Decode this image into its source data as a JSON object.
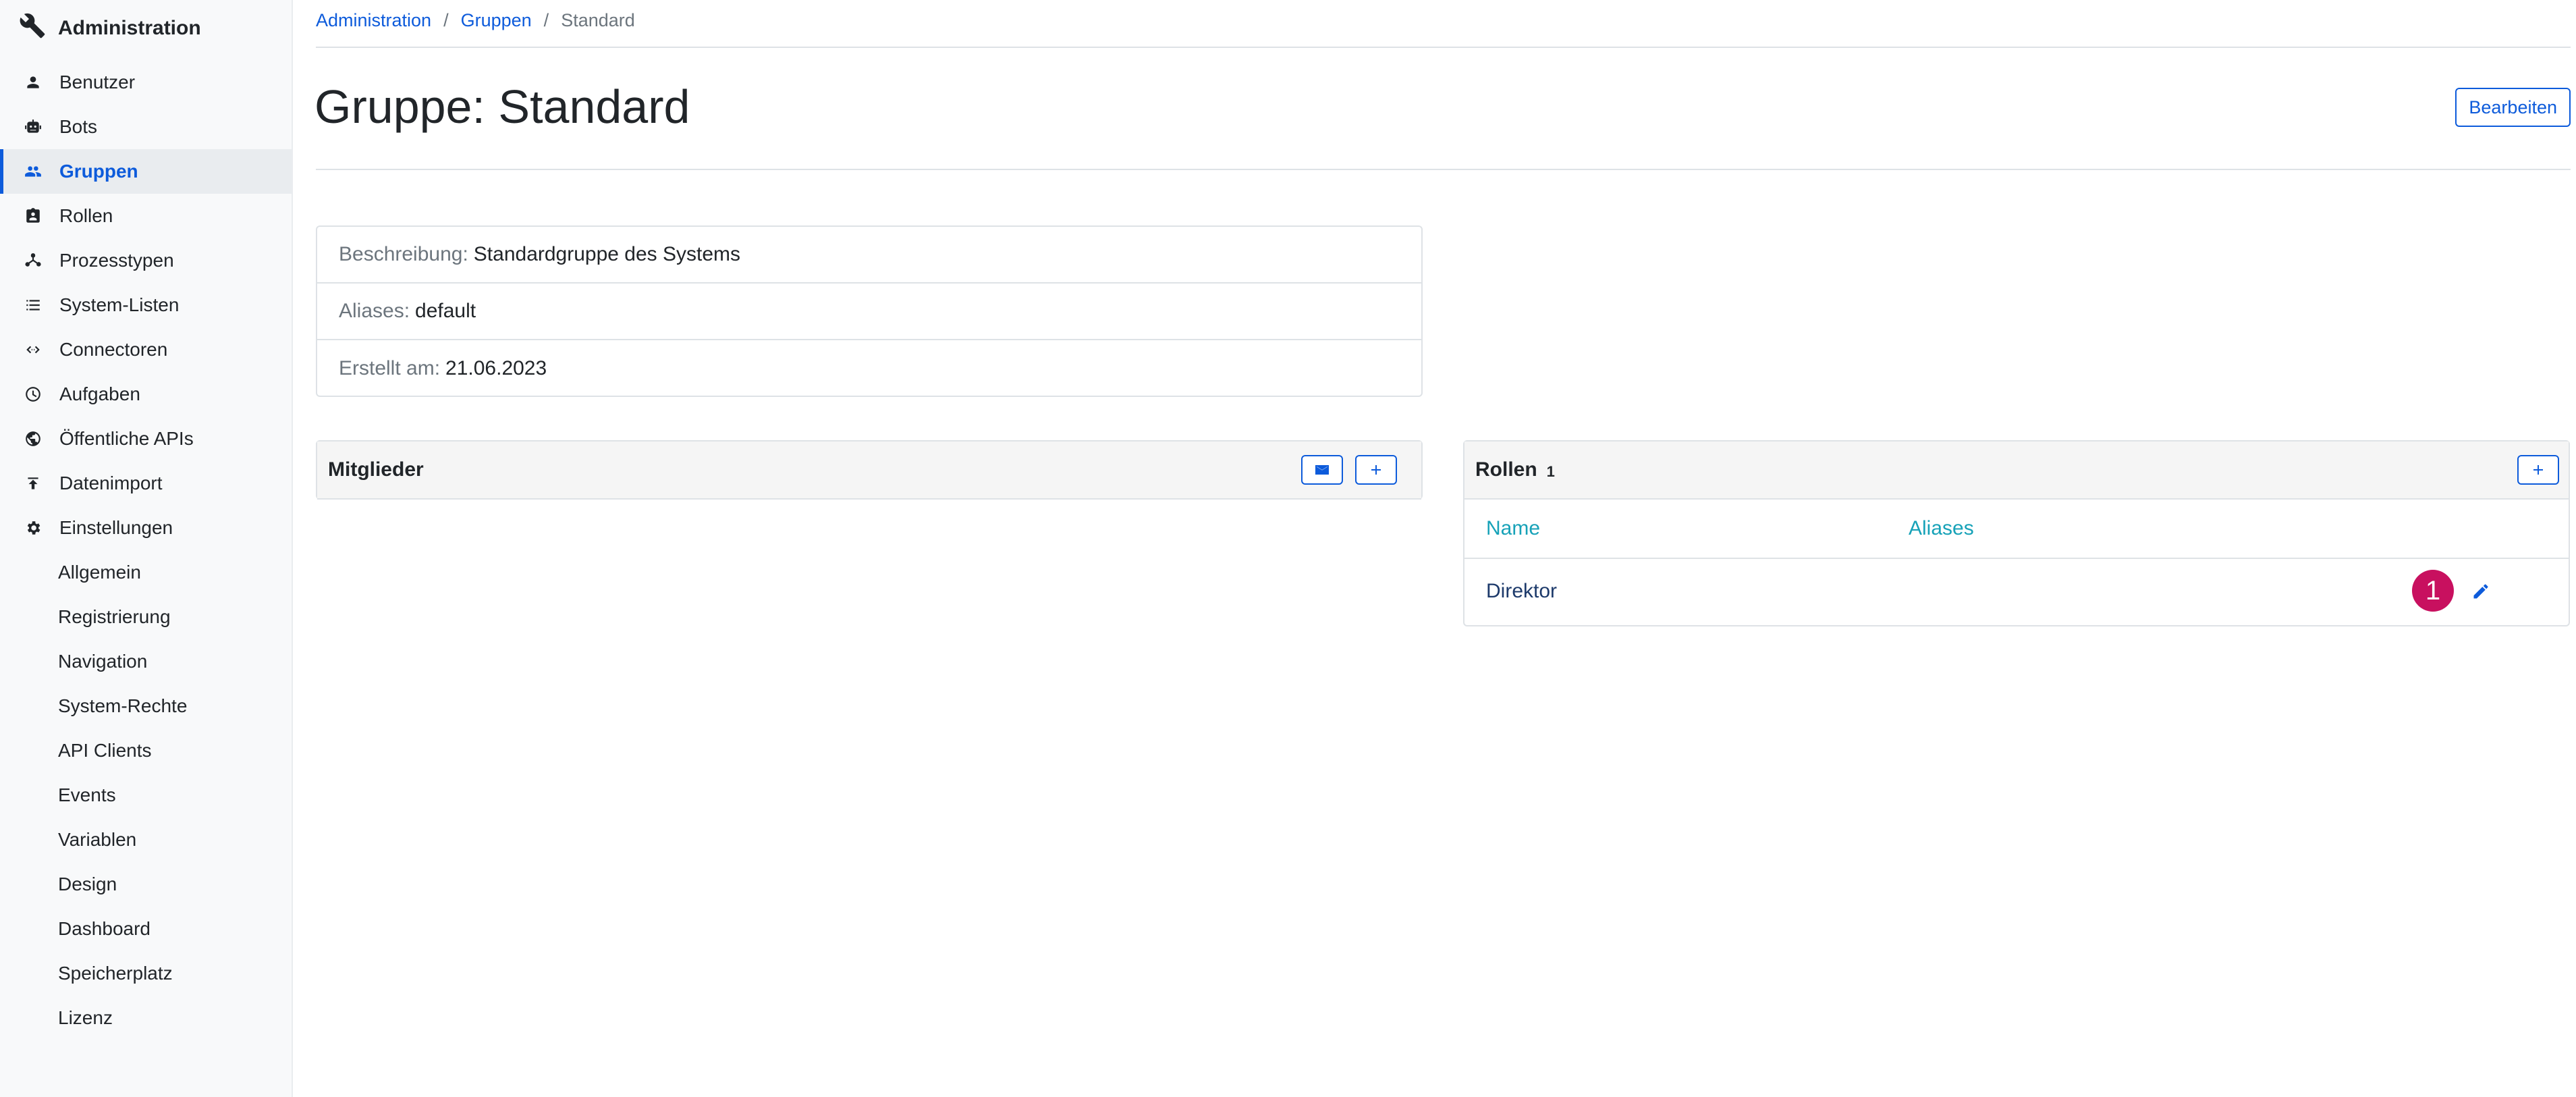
{
  "sidebar": {
    "brand": {
      "title": "Administration",
      "icon": "wrench-icon"
    },
    "items": [
      {
        "label": "Benutzer",
        "icon": "person-icon"
      },
      {
        "label": "Bots",
        "icon": "robot-icon"
      },
      {
        "label": "Gruppen",
        "icon": "people-icon",
        "active": true
      },
      {
        "label": "Rollen",
        "icon": "id-badge-icon"
      },
      {
        "label": "Prozesstypen",
        "icon": "fork-icon"
      },
      {
        "label": "System-Listen",
        "icon": "list-icon"
      },
      {
        "label": "Connectoren",
        "icon": "code-arrows-icon"
      },
      {
        "label": "Aufgaben",
        "icon": "clock-icon"
      },
      {
        "label": "Öffentliche APIs",
        "icon": "globe-icon"
      },
      {
        "label": "Datenimport",
        "icon": "upload-icon"
      },
      {
        "label": "Einstellungen",
        "icon": "gear-icon"
      }
    ],
    "sub_items": [
      "Allgemein",
      "Registrierung",
      "Navigation",
      "System-Rechte",
      "API Clients",
      "Events",
      "Variablen",
      "Design",
      "Dashboard",
      "Speicherplatz",
      "Lizenz"
    ]
  },
  "breadcrumb": {
    "items": [
      "Administration",
      "Gruppen",
      "Standard"
    ],
    "separator": "/"
  },
  "header": {
    "title": "Gruppe: Standard",
    "edit_label": "Bearbeiten"
  },
  "info": {
    "description_label": "Beschreibung:",
    "description_value": "Standardgruppe des Systems",
    "aliases_label": "Aliases:",
    "aliases_value": "default",
    "created_label": "Erstellt am:",
    "created_value": "21.06.2023"
  },
  "members": {
    "title": "Mitglieder"
  },
  "roles": {
    "title": "Rollen",
    "count": "1",
    "columns": {
      "name": "Name",
      "aliases": "Aliases"
    },
    "rows": [
      {
        "name": "Direktor",
        "aliases": "",
        "badge": "1"
      }
    ]
  },
  "colors": {
    "accent": "#0d5bdb",
    "badge": "#c8105f",
    "table_header": "#17a2b8"
  }
}
